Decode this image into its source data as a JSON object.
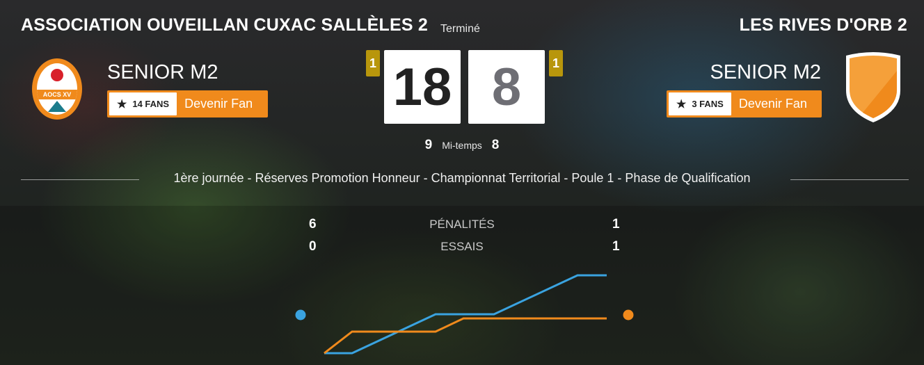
{
  "home": {
    "name": "ASSOCIATION OUVEILLAN CUXAC SALLÈLES 2",
    "category": "SENIOR M2",
    "fans": "14 FANS",
    "fan_button": "Devenir Fan",
    "score": "18",
    "bonus": "1",
    "half_time": "9",
    "logo_text": "AOCS XV"
  },
  "away": {
    "name": "LES RIVES D'ORB 2",
    "category": "SENIOR M2",
    "fans": "3 FANS",
    "fan_button": "Devenir Fan",
    "score": "8",
    "bonus": "1",
    "half_time": "8"
  },
  "match": {
    "status": "Terminé",
    "half_label": "Mi-temps",
    "competition": "1ère journée - Réserves Promotion Honneur - Championnat Territorial - Poule 1 - Phase de Qualification"
  },
  "stats": [
    {
      "label": "PÉNALITÉS",
      "home": "6",
      "away": "1"
    },
    {
      "label": "ESSAIS",
      "home": "0",
      "away": "1"
    }
  ],
  "colors": {
    "accent": "#f08a1c",
    "badge": "#b8960c",
    "home_line": "#3aa3e0",
    "away_line": "#f08a1c"
  },
  "icons": {
    "fan": "star-icon",
    "home_logo": "aocs-logo",
    "away_logo": "orange-shield-icon"
  }
}
